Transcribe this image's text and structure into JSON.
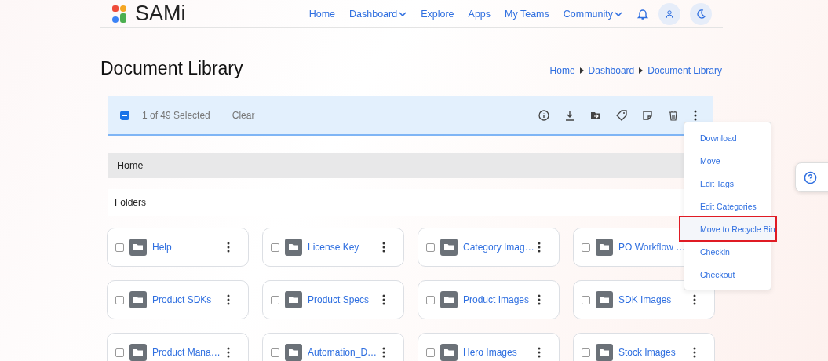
{
  "brand": {
    "name": "SAMi"
  },
  "nav": [
    {
      "label": "Home",
      "dropdown": false
    },
    {
      "label": "Dashboard",
      "dropdown": true
    },
    {
      "label": "Explore",
      "dropdown": false
    },
    {
      "label": "Apps",
      "dropdown": false
    },
    {
      "label": "My Teams",
      "dropdown": false
    },
    {
      "label": "Community",
      "dropdown": true
    }
  ],
  "page": {
    "title": "Document Library",
    "breadcrumb": [
      "Home",
      "Dashboard",
      "Document Library"
    ]
  },
  "selection_bar": {
    "checked": true,
    "count": "1 of 49 Selected",
    "clear": "Clear"
  },
  "path": "Home",
  "section": "Folders",
  "folders": [
    {
      "name": "Help",
      "checked": false
    },
    {
      "name": "License Key",
      "checked": false
    },
    {
      "name": "Category Imag…",
      "checked": false
    },
    {
      "name": "PO Workflow …",
      "checked": false
    },
    {
      "name": "Product SDKs",
      "checked": false
    },
    {
      "name": "Product Specs",
      "checked": false
    },
    {
      "name": "Product Images",
      "checked": false
    },
    {
      "name": "SDK Images",
      "checked": false
    },
    {
      "name": "Product Mana…",
      "checked": false
    },
    {
      "name": "Automation_D…",
      "checked": false
    },
    {
      "name": "Hero Images",
      "checked": false
    },
    {
      "name": "Stock Images",
      "checked": false
    }
  ],
  "menu": [
    {
      "label": "Download",
      "highlighted": false
    },
    {
      "label": "Move",
      "highlighted": false
    },
    {
      "label": "Edit Tags",
      "highlighted": false
    },
    {
      "label": "Edit Categories",
      "highlighted": false
    },
    {
      "label": "Move to Recycle Bin",
      "highlighted": true
    },
    {
      "label": "Checkin",
      "highlighted": false
    },
    {
      "label": "Checkout",
      "highlighted": false
    }
  ]
}
